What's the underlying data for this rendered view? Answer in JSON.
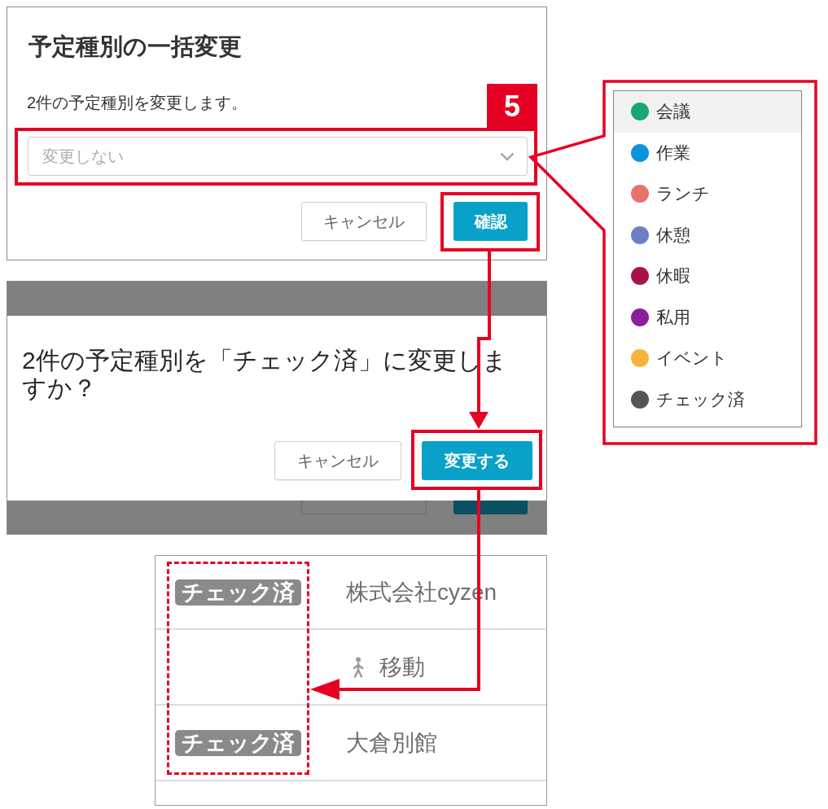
{
  "step_badge": "5",
  "bulk_change_dialog": {
    "title": "予定種別の一括変更",
    "message": "2件の予定種別を変更します。",
    "select": {
      "placeholder": "変更しない",
      "highlighted": true
    },
    "buttons": [
      {
        "label": "キャンセル",
        "kind": "secondary",
        "highlighted": false
      },
      {
        "label": "確認",
        "kind": "primary",
        "highlighted": true
      }
    ]
  },
  "type_dropdown": {
    "options": [
      {
        "label": "会議",
        "color": "#17a86f",
        "selected": true
      },
      {
        "label": "作業",
        "color": "#0a93df",
        "selected": false
      },
      {
        "label": "ランチ",
        "color": "#eb716f",
        "selected": false
      },
      {
        "label": "休憩",
        "color": "#6e7ec3",
        "selected": false
      },
      {
        "label": "休暇",
        "color": "#a8124a",
        "selected": false
      },
      {
        "label": "私用",
        "color": "#8b1f9b",
        "selected": false
      },
      {
        "label": "イベント",
        "color": "#f6b43c",
        "selected": false
      },
      {
        "label": "チェック済",
        "color": "#555555",
        "selected": false
      }
    ]
  },
  "confirm_dialog": {
    "message": "2件の予定種別を「チェック済」に変更しますか？",
    "buttons": [
      {
        "label": "キャンセル",
        "kind": "secondary",
        "highlighted": false
      },
      {
        "label": "変更する",
        "kind": "primary",
        "highlighted": true
      }
    ]
  },
  "schedule_list": {
    "tag_column_highlighted": true,
    "rows": [
      {
        "kind": "tagged",
        "tag": "チェック済",
        "title": "株式会社cyzen"
      },
      {
        "kind": "travel",
        "title": "移動"
      },
      {
        "kind": "tagged",
        "tag": "チェック済",
        "title": "大倉別館"
      }
    ]
  }
}
